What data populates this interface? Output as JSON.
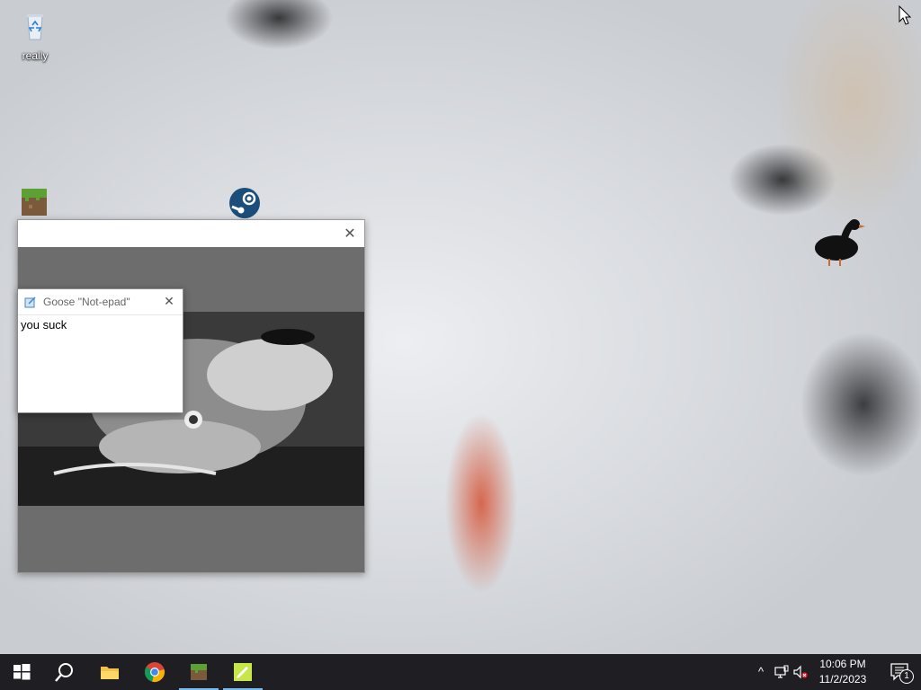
{
  "desktop": {
    "icons": [
      {
        "label": "really",
        "icon": "recycle-bin-icon"
      },
      {
        "label": "",
        "icon": "minecraft-icon"
      },
      {
        "label": "",
        "icon": "steam-icon"
      }
    ]
  },
  "main_window": {
    "title": "",
    "close_label": "✕"
  },
  "notepad": {
    "title": "Goose \"Not-epad\"",
    "text": "you suck",
    "close_label": "✕"
  },
  "taskbar": {
    "apps": [
      {
        "icon": "windows-start-icon"
      },
      {
        "icon": "search-icon"
      },
      {
        "icon": "file-explorer-icon"
      },
      {
        "icon": "chrome-icon"
      },
      {
        "icon": "minecraft-icon",
        "active": true
      },
      {
        "icon": "notepad-icon",
        "active": true
      }
    ],
    "tray": {
      "chevron": "^",
      "time": "10:06 PM",
      "date": "11/2/2023",
      "notification_count": "1"
    }
  },
  "colors": {
    "taskbar_bg": "#1f1f23",
    "active_indicator": "#76b9ed"
  }
}
